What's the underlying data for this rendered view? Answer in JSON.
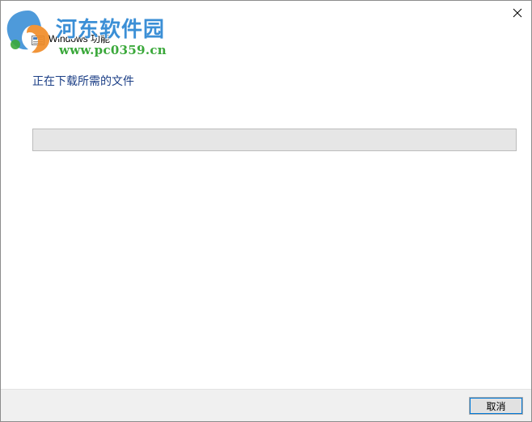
{
  "window": {
    "title": "Windows 功能",
    "close_icon": "close-icon"
  },
  "watermark": {
    "title": "河东软件园",
    "url": "www.pc0359.cn"
  },
  "content": {
    "status_text": "正在下载所需的文件",
    "progress": 0
  },
  "footer": {
    "cancel_label": "取消"
  },
  "colors": {
    "status_text": "#1c3f86",
    "progress_track": "#e6e6e6",
    "footer_bg": "#f0f0f0",
    "watermark_blue": "#3b8fd6",
    "watermark_green": "#3aa83a"
  }
}
